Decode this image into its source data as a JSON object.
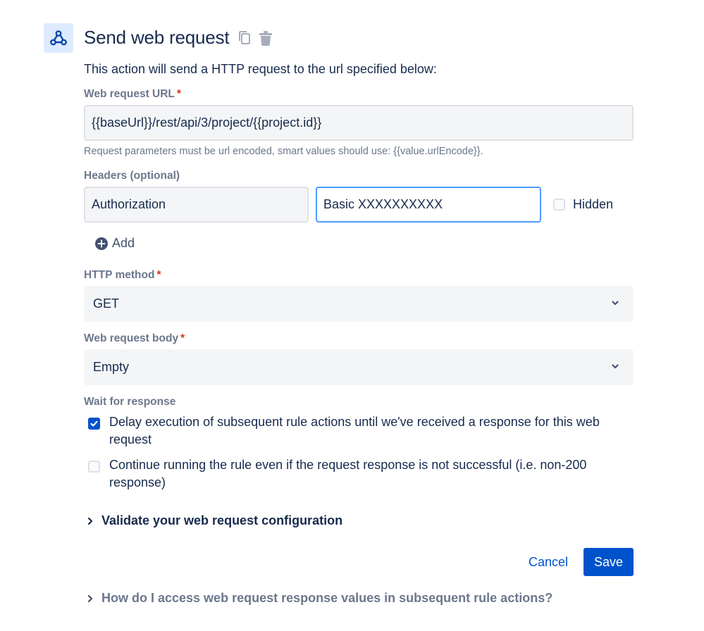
{
  "header": {
    "icon": "webhook-icon",
    "title": "Send web request",
    "actions": [
      "copy-icon",
      "trash-icon"
    ]
  },
  "intro": "This action will send a HTTP request to the url specified below:",
  "url": {
    "label": "Web request URL",
    "required_mark": "*",
    "value": "{{baseUrl}}/rest/api/3/project/{{project.id}}",
    "help": "Request parameters must be url encoded, smart values should use: {{value.urlEncode}}."
  },
  "headers": {
    "label": "Headers (optional)",
    "rows": [
      {
        "name": "Authorization",
        "value": "Basic XXXXXXXXXX",
        "hidden_label": "Hidden",
        "hidden_checked": false
      }
    ],
    "add_label": "Add"
  },
  "method": {
    "label": "HTTP method",
    "required_mark": "*",
    "selected": "GET"
  },
  "body": {
    "label": "Web request body",
    "required_mark": "*",
    "selected": "Empty"
  },
  "wait": {
    "label": "Wait for response",
    "options": [
      {
        "line1": "Delay execution of subsequent rule actions until we've received a response for this web",
        "line2": "request",
        "checked": true
      },
      {
        "line1": "Continue running the rule even if the request response is not successful (i.e. non-200",
        "line2": "response)",
        "checked": false
      }
    ]
  },
  "validate": {
    "label": "Validate your web request configuration"
  },
  "buttons": {
    "cancel": "Cancel",
    "save": "Save"
  },
  "faq": {
    "label": "How do I access web request response values in subsequent rule actions?"
  },
  "colors": {
    "primary": "#0052cc",
    "text": "#172b4d",
    "subtle": "#6b778c",
    "required": "#de350b",
    "focus": "#4c9aff"
  }
}
